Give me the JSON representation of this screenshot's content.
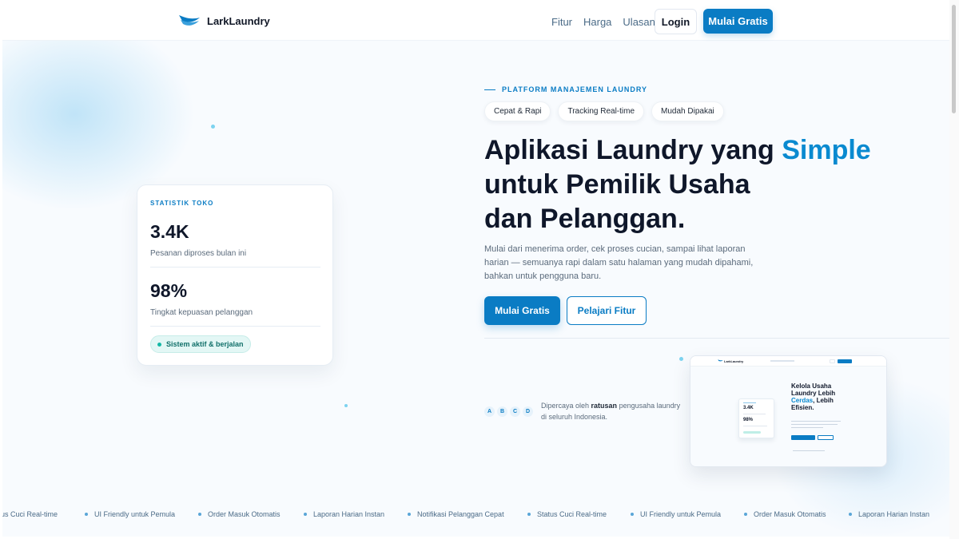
{
  "header": {
    "brand": "LarkLaundry",
    "nav": [
      "Fitur",
      "Harga",
      "Ulasan"
    ],
    "login_label": "Login",
    "cta_label": "Mulai Gratis"
  },
  "stats": {
    "label": "STATISTIK TOKO",
    "orders_value": "3.4K",
    "orders_desc": "Pesanan diproses bulan ini",
    "satisfaction_value": "98%",
    "satisfaction_desc": "Tingkat kepuasan pelanggan",
    "status": "Sistem aktif & berjalan"
  },
  "hero": {
    "eyebrow": "PLATFORM MANAJEMEN LAUNDRY",
    "chips": [
      "Cepat & Rapi",
      "Tracking Real-time",
      "Mudah Dipakai"
    ],
    "title_part1": "Aplikasi Laundry yang ",
    "title_accent": "Simple",
    "title_line2": "untuk Pemilik Usaha",
    "title_line3": "dan Pelanggan.",
    "description": "Mulai dari menerima order, cek proses cucian, sampai lihat laporan harian — semuanya rapi dalam satu halaman yang mudah dipahami, bahkan untuk pengguna baru.",
    "primary_button": "Mulai Gratis",
    "secondary_button": "Pelajari Fitur"
  },
  "trust": {
    "avatars": [
      "A",
      "B",
      "C",
      "D"
    ],
    "text_prefix": "Dipercaya oleh ",
    "text_bold": "ratusan",
    "text_suffix": " pengusaha laundry di seluruh Indonesia."
  },
  "preview": {
    "brand": "LarkLaundry",
    "stat1": "3.4K",
    "stat2": "98%",
    "title_part1": "Kelola Usaha Laundry Lebih ",
    "title_accent": "Cerdas",
    "title_part2": ", Lebih Efisien."
  },
  "marquee": {
    "items": [
      "Status Cuci Real-time",
      "UI Friendly untuk Pemula",
      "Order Masuk Otomatis",
      "Laporan Harian Instan",
      "Notifikasi Pelanggan Cepat",
      "Status Cuci Real-time",
      "UI Friendly untuk Pemula",
      "Order Masuk Otomatis",
      "Laporan Harian Instan"
    ]
  },
  "colors": {
    "primary": "#0a7cc4",
    "accent": "#0a8ad0",
    "success": "#14b8a6"
  }
}
